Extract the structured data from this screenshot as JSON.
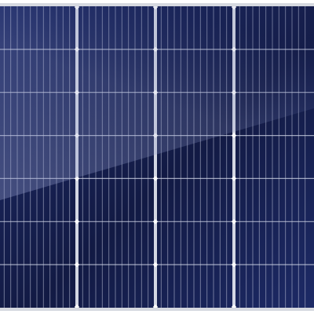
{
  "image": {
    "subject": "solar-panel",
    "panel": {
      "cell_columns": 4,
      "cell_rows": 7,
      "fingers_per_cell": 11,
      "cell_type": "monocrystalline-half-cut"
    },
    "colors": {
      "cell_dark": "#121a44",
      "cell_mid": "#1d2a66",
      "cell_light": "#2c3a7e",
      "cell_line": "#cfd4e6",
      "busbar": "#e8ebf3",
      "frame": "#d6d9e0",
      "frame_edge": "#aeb3bf",
      "glare": "#8e98c8",
      "background": "#ffffff"
    }
  }
}
